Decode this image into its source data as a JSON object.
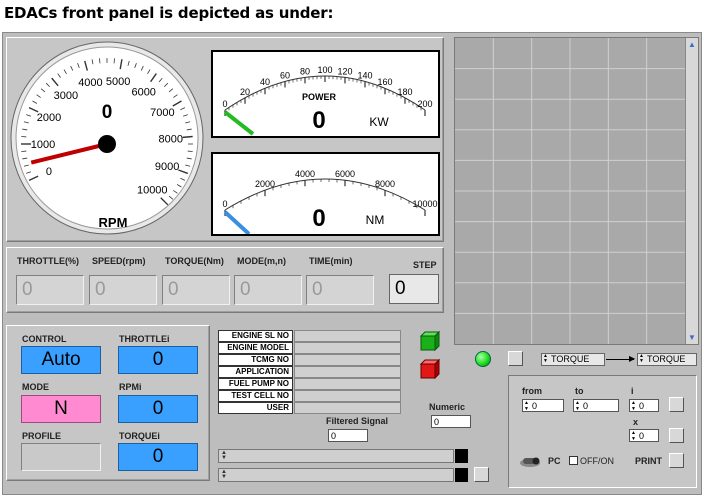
{
  "heading": "EDACs front panel is depicted as under:",
  "rpm_gauge": {
    "label": "RPM",
    "value": "0",
    "ticks": [
      "0",
      "1000",
      "2000",
      "3000",
      "4000",
      "5000",
      "6000",
      "7000",
      "8000",
      "9000",
      "10000"
    ],
    "min": 0,
    "max": 10000,
    "needle_value": 450
  },
  "power_gauge": {
    "label": "POWER",
    "unit": "KW",
    "value": "0",
    "ticks": [
      "0",
      "20",
      "40",
      "60",
      "80",
      "100",
      "120",
      "140",
      "160",
      "180",
      "200"
    ],
    "min": 0,
    "max": 200
  },
  "torque_gauge": {
    "unit": "NM",
    "value": "0",
    "ticks": [
      "0",
      "2000",
      "4000",
      "6000",
      "8000",
      "10000"
    ],
    "min": 0,
    "max": 10000
  },
  "readouts": {
    "headers": [
      "THROTTLE(%)",
      "SPEED(rpm)",
      "TORQUE(Nm)",
      "MODE(m,n)",
      "TIME(min)"
    ],
    "values": [
      "0",
      "0",
      "0",
      "0",
      "0"
    ],
    "step_label": "STEP",
    "step_value": "0"
  },
  "controls": {
    "control_label": "CONTROL",
    "control_value": "Auto",
    "mode_label": "MODE",
    "mode_value": "N",
    "profile_label": "PROFILE",
    "throttlei_label": "THROTTLEi",
    "throttlei_value": "0",
    "rpmi_label": "RPMi",
    "rpmi_value": "0",
    "torquei_label": "TORQUEi",
    "torquei_value": "0"
  },
  "info_table": {
    "rows": [
      "ENGINE SL NO",
      "ENGINE MODEL",
      "TCMG NO",
      "APPLICATION",
      "FUEL PUMP NO",
      "TEST CELL NO",
      "USER"
    ]
  },
  "filtered_signal": {
    "label": "Filtered Signal",
    "value": "0"
  },
  "numeric": {
    "label": "Numeric",
    "value": "0"
  },
  "selectors": {
    "left": "TORQUE",
    "right": "TORQUE"
  },
  "range_panel": {
    "from_label": "from",
    "from_value": "0",
    "to_label": "to",
    "to_value": "0",
    "i_label": "i",
    "i_value": "0",
    "x_label": "x",
    "x_value": "0",
    "pc_label": "PC",
    "offon_label": "OFF/ON",
    "print_label": "PRINT"
  },
  "colors": {
    "panel": "#bdbdbd",
    "blue_display": "#3aa0ff",
    "pink_display": "#ff8ad2",
    "green_led": "#22dd22",
    "green_button": "#22cc22",
    "red_button": "#ee2222",
    "needle": "#cc0000"
  }
}
